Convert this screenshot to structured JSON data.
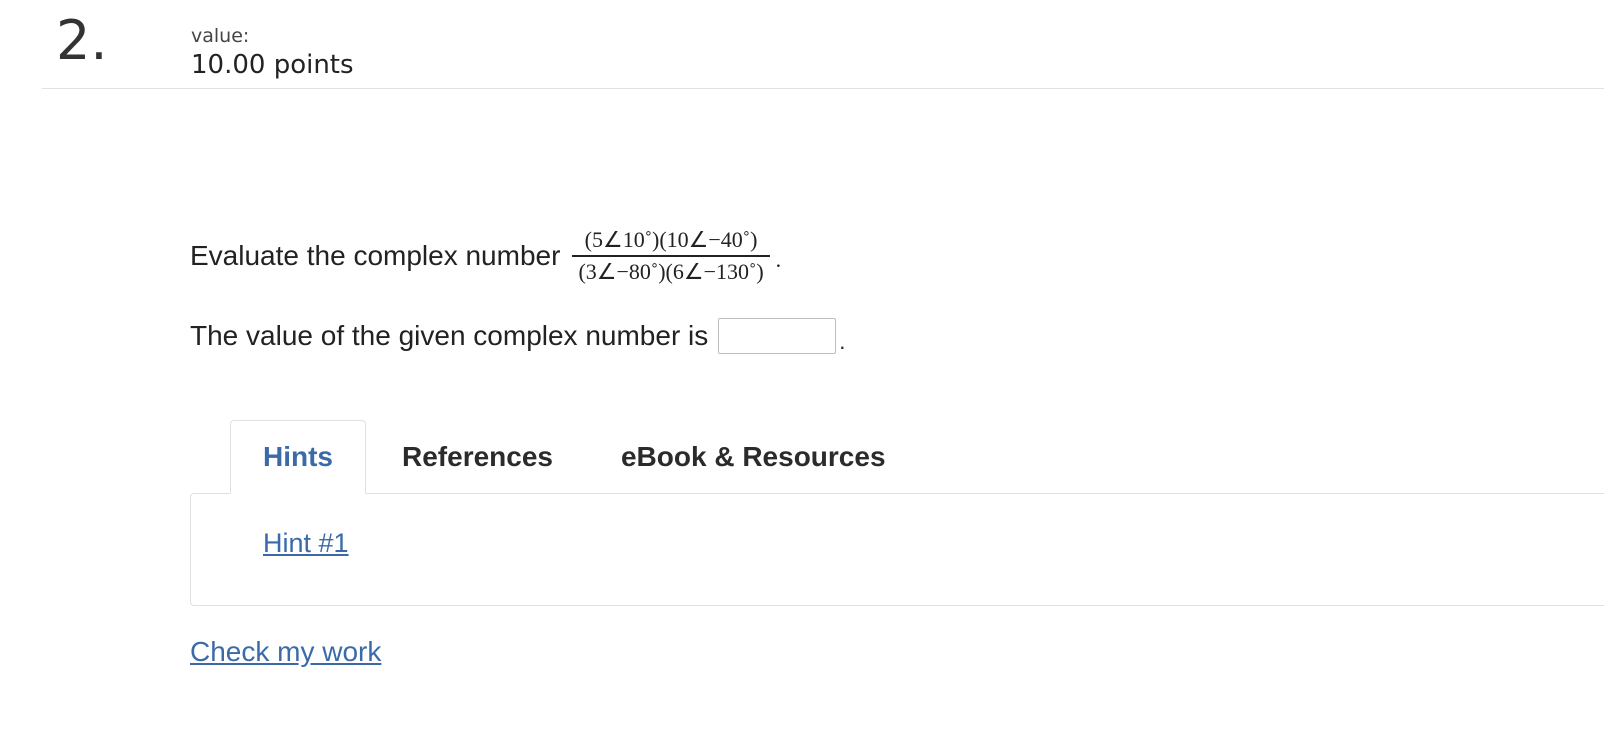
{
  "question": {
    "number": "2.",
    "value_label": "value:",
    "points": "10.00 points"
  },
  "prompt": {
    "text": "Evaluate the complex number",
    "fraction_numerator": "(5∠10˚)(10∠−40˚)",
    "fraction_denominator": "(3∠−80˚)(6∠−130˚)",
    "end_punct": "."
  },
  "answer": {
    "text": "The value of the given complex number is",
    "input_value": "",
    "end_punct": "."
  },
  "tabs": [
    {
      "label": "Hints",
      "active": true
    },
    {
      "label": "References",
      "active": false
    },
    {
      "label": "eBook & Resources",
      "active": false
    }
  ],
  "hints": {
    "items": [
      {
        "label": "Hint #1"
      }
    ]
  },
  "actions": {
    "check_label": "Check my work"
  },
  "colors": {
    "link": "#3a6aa8",
    "text": "#222222",
    "divider": "#e2e2e2"
  }
}
